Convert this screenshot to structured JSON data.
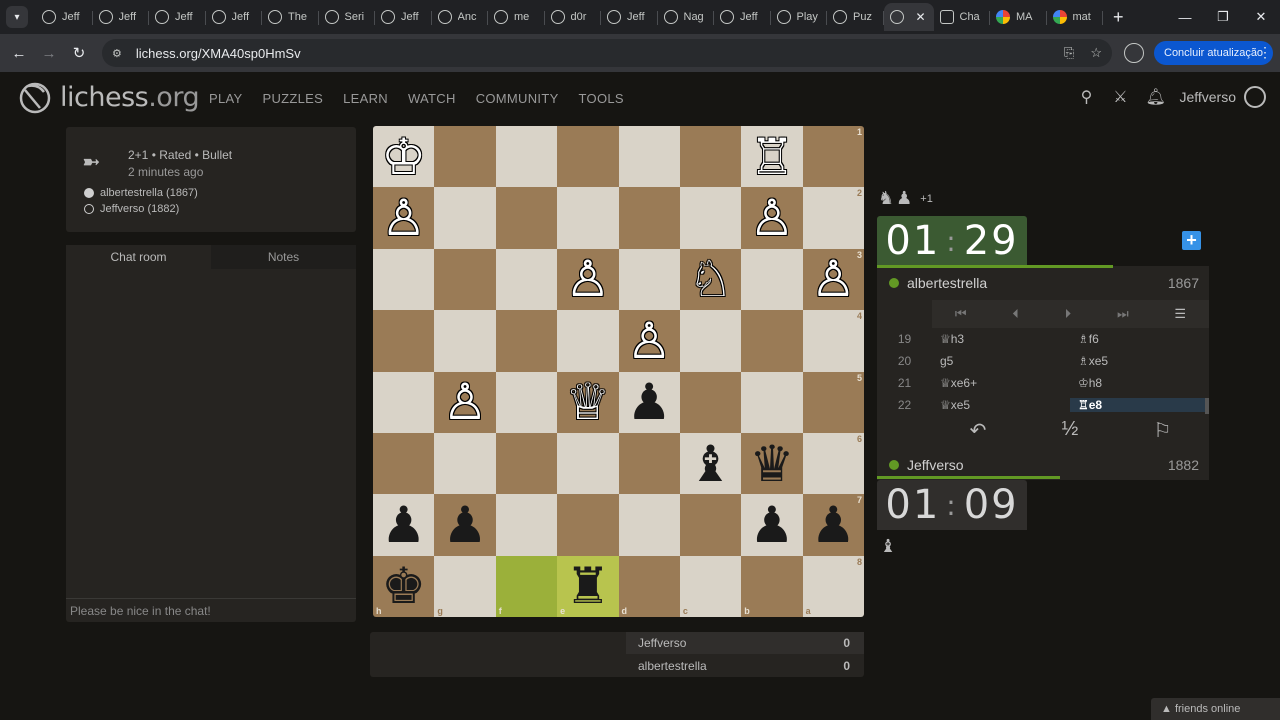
{
  "browser": {
    "tabs": [
      {
        "label": "Jeff",
        "icon": "lichess"
      },
      {
        "label": "Jeff",
        "icon": "lichess"
      },
      {
        "label": "Jeff",
        "icon": "lichess"
      },
      {
        "label": "Jeff",
        "icon": "lichess"
      },
      {
        "label": "The",
        "icon": "lichess"
      },
      {
        "label": "Seri",
        "icon": "lichess"
      },
      {
        "label": "Jeff",
        "icon": "lichess"
      },
      {
        "label": "Anc",
        "icon": "lichess"
      },
      {
        "label": "me",
        "icon": "lichess"
      },
      {
        "label": "d0r",
        "icon": "lichess"
      },
      {
        "label": "Jeff",
        "icon": "lichess"
      },
      {
        "label": "Nag",
        "icon": "lichess"
      },
      {
        "label": "Jeff",
        "icon": "lichess"
      },
      {
        "label": "Play",
        "icon": "lichess"
      },
      {
        "label": "Puz",
        "icon": "lichess"
      }
    ],
    "active_tab_close": "✕",
    "tabs_after": [
      {
        "label": "Cha",
        "icon": "ai"
      },
      {
        "label": "MA",
        "icon": "google"
      },
      {
        "label": "mat",
        "icon": "google"
      }
    ],
    "url": "lichess.org/XMA40sp0HmSv",
    "update_button": "Concluir atualização"
  },
  "header": {
    "logo_main": "lichess",
    "logo_tld": ".org",
    "nav": [
      "PLAY",
      "PUZZLES",
      "LEARN",
      "WATCH",
      "COMMUNITY",
      "TOOLS"
    ],
    "username": "Jeffverso"
  },
  "game": {
    "type": "2+1 • Rated • Bullet",
    "time_ago": "2 minutes ago",
    "white_player": "albertestrella (1867)",
    "black_player": "Jeffverso (1882)"
  },
  "chat": {
    "tab_chat": "Chat room",
    "tab_notes": "Notes",
    "placeholder": "Please be nice in the chat!"
  },
  "board": {
    "ranks": [
      "1",
      "2",
      "3",
      "4",
      "5",
      "6",
      "7",
      "8"
    ],
    "files": [
      "h",
      "g",
      "f",
      "e",
      "d",
      "c",
      "b",
      "a"
    ],
    "rows": [
      [
        {
          "p": "♔",
          "c": "w"
        },
        null,
        null,
        null,
        null,
        null,
        {
          "p": "♖",
          "c": "w"
        },
        null
      ],
      [
        {
          "p": "♙",
          "c": "w"
        },
        null,
        null,
        null,
        null,
        null,
        {
          "p": "♙",
          "c": "w"
        },
        null
      ],
      [
        null,
        null,
        null,
        {
          "p": "♙",
          "c": "w"
        },
        null,
        {
          "p": "♘",
          "c": "w"
        },
        null,
        {
          "p": "♙",
          "c": "w"
        }
      ],
      [
        null,
        null,
        null,
        null,
        {
          "p": "♙",
          "c": "w"
        },
        null,
        null,
        null
      ],
      [
        null,
        {
          "p": "♙",
          "c": "w"
        },
        null,
        {
          "p": "♕",
          "c": "w"
        },
        {
          "p": "♟",
          "c": "b"
        },
        null,
        null,
        null
      ],
      [
        null,
        null,
        null,
        null,
        null,
        {
          "p": "♝",
          "c": "b"
        },
        {
          "p": "♛",
          "c": "b"
        },
        null
      ],
      [
        {
          "p": "♟",
          "c": "b"
        },
        {
          "p": "♟",
          "c": "b"
        },
        null,
        null,
        null,
        null,
        {
          "p": "♟",
          "c": "b"
        },
        {
          "p": "♟",
          "c": "b"
        }
      ],
      [
        {
          "p": "♚",
          "c": "b"
        },
        null,
        null,
        {
          "p": "♜",
          "c": "b"
        },
        null,
        null,
        null,
        null
      ]
    ],
    "highlight": [
      [
        7,
        2
      ],
      [
        7,
        3
      ]
    ]
  },
  "opponent": {
    "name": "albertestrella",
    "rating": "1867",
    "clock_min": "01",
    "clock_sec": "29",
    "material_plus": "+1"
  },
  "me": {
    "name": "Jeffverso",
    "rating": "1882",
    "clock_min": "01",
    "clock_sec": "09"
  },
  "moves": [
    {
      "no": "19",
      "white": "♕h3",
      "black": "♗f6"
    },
    {
      "no": "20",
      "white": "g5",
      "black": "♗xe5"
    },
    {
      "no": "21",
      "white": "♕xe6+",
      "black": "♔h8"
    },
    {
      "no": "22",
      "white": "♕xe5",
      "black": "♖e8"
    }
  ],
  "crosstable": [
    {
      "name": "Jeffverso",
      "score": "0"
    },
    {
      "name": "albertestrella",
      "score": "0"
    }
  ],
  "footer": {
    "friends": "▲ friends online"
  },
  "actions": {
    "takeback": "↶",
    "draw": "½",
    "resign": "⚐"
  }
}
